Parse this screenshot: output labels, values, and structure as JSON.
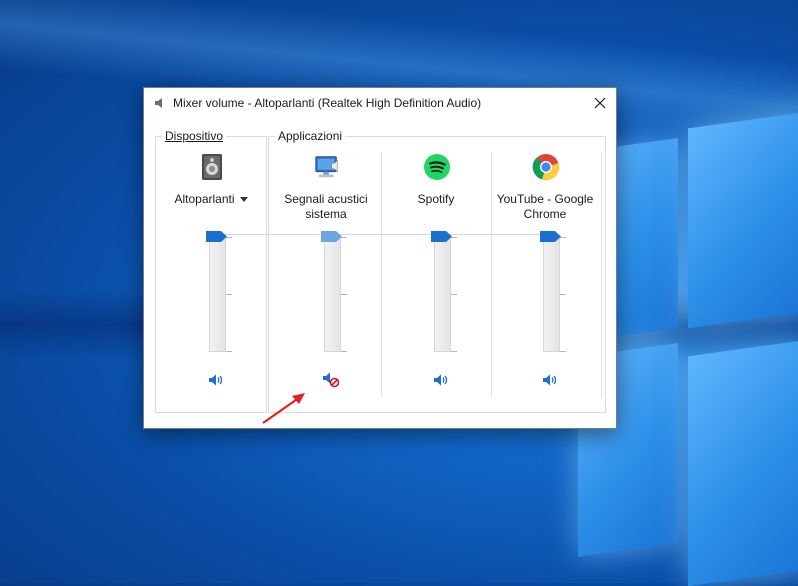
{
  "window": {
    "title": "Mixer volume - Altoparlanti (Realtek High Definition Audio)"
  },
  "device_section": {
    "label": "Dispositivo",
    "channel": {
      "name": "Altoparlanti",
      "icon": "speaker-device-icon",
      "level": 1.0,
      "muted": false
    }
  },
  "apps_section": {
    "label": "Applicazioni",
    "channels": [
      {
        "name_line1": "Segnali acustici",
        "name_line2": "sistema",
        "icon": "system-sounds-icon",
        "level": 1.0,
        "muted": true
      },
      {
        "name_line1": "Spotify",
        "name_line2": "",
        "icon": "spotify-icon",
        "level": 1.0,
        "muted": false
      },
      {
        "name_line1": "YouTube - Google",
        "name_line2": "Chrome",
        "icon": "chrome-icon",
        "level": 1.0,
        "muted": false
      }
    ]
  },
  "colors": {
    "accent": "#1a6fd1",
    "muted_thumb": "#6aa6df",
    "mute_badge": "#d8161b",
    "annotation_arrow": "#e02020"
  }
}
